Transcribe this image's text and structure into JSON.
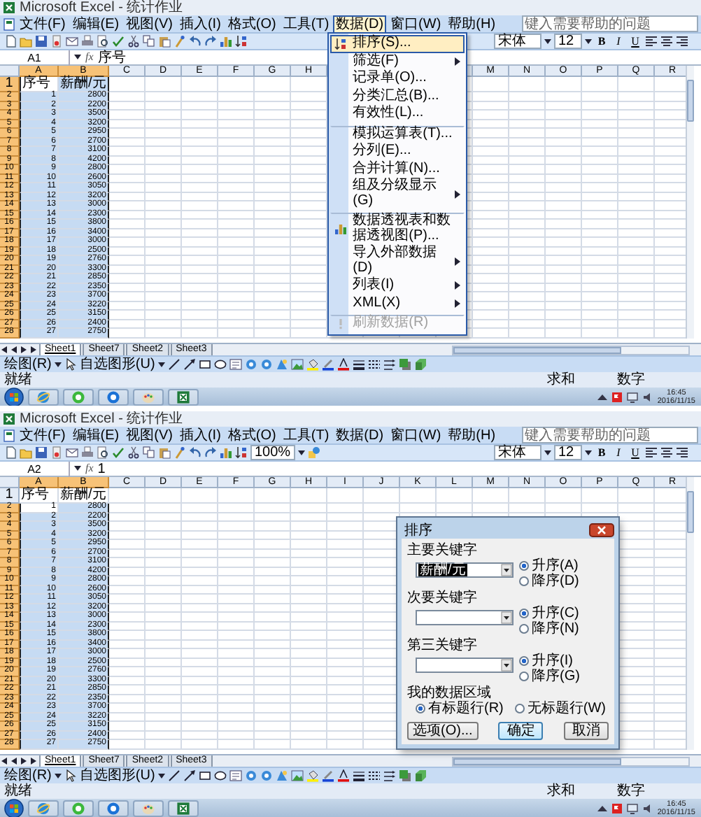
{
  "windows": [
    {
      "title": "Microsoft Excel - 统计作业",
      "menu": [
        {
          "label": "文件(F)",
          "selected": false
        },
        {
          "label": "编辑(E)",
          "selected": false
        },
        {
          "label": "视图(V)",
          "selected": false
        },
        {
          "label": "插入(I)",
          "selected": false
        },
        {
          "label": "格式(O)",
          "selected": false
        },
        {
          "label": "工具(T)",
          "selected": false
        },
        {
          "label": "数据(D)",
          "selected": true
        },
        {
          "label": "窗口(W)",
          "selected": false
        },
        {
          "label": "帮助(H)",
          "selected": false
        }
      ],
      "help_placeholder": "键入需要帮助的问题",
      "dropdown": [
        {
          "label": "排序(S)...",
          "kind": "sort",
          "selected": true,
          "submenu": false,
          "disabled": false,
          "group_start": false
        },
        {
          "label": "筛选(F)",
          "kind": "plain",
          "selected": false,
          "submenu": true,
          "disabled": false,
          "group_start": false
        },
        {
          "label": "记录单(O)...",
          "kind": "plain",
          "selected": false,
          "submenu": false,
          "disabled": false,
          "group_start": false
        },
        {
          "label": "分类汇总(B)...",
          "kind": "plain",
          "selected": false,
          "submenu": false,
          "disabled": false,
          "group_start": false
        },
        {
          "label": "有效性(L)...",
          "kind": "plain",
          "selected": false,
          "submenu": false,
          "disabled": false,
          "group_start": false
        },
        {
          "label": "模拟运算表(T)...",
          "kind": "plain",
          "selected": false,
          "submenu": false,
          "disabled": false,
          "group_start": true
        },
        {
          "label": "分列(E)...",
          "kind": "plain",
          "selected": false,
          "submenu": false,
          "disabled": false,
          "group_start": false
        },
        {
          "label": "合并计算(N)...",
          "kind": "plain",
          "selected": false,
          "submenu": false,
          "disabled": false,
          "group_start": false
        },
        {
          "label": "组及分级显示(G)",
          "kind": "plain",
          "selected": false,
          "submenu": true,
          "disabled": false,
          "group_start": false
        },
        {
          "label": "数据透视表和数据透视图(P)...",
          "kind": "pivot",
          "selected": false,
          "submenu": false,
          "disabled": false,
          "group_start": true
        },
        {
          "label": "导入外部数据(D)",
          "kind": "plain",
          "selected": false,
          "submenu": true,
          "disabled": false,
          "group_start": false
        },
        {
          "label": "列表(I)",
          "kind": "plain",
          "selected": false,
          "submenu": true,
          "disabled": false,
          "group_start": false
        },
        {
          "label": "XML(X)",
          "kind": "plain",
          "selected": false,
          "submenu": true,
          "disabled": false,
          "group_start": false
        },
        {
          "label": "刷新数据(R)",
          "kind": "refresh",
          "selected": false,
          "submenu": false,
          "disabled": true,
          "group_start": true
        }
      ],
      "font_name": "宋体",
      "font_size": "12",
      "format_buttons": [
        "B",
        "I",
        "U"
      ],
      "name_box": "A1",
      "formula_symbol": "fx",
      "formula": "序号",
      "columns": [
        {
          "label": "A",
          "selected": true
        },
        {
          "label": "B",
          "selected": true
        },
        {
          "label": "C",
          "selected": false
        },
        {
          "label": "D",
          "selected": false
        },
        {
          "label": "E",
          "selected": false
        },
        {
          "label": "F",
          "selected": false
        },
        {
          "label": "G",
          "selected": false
        },
        {
          "label": "H",
          "selected": false
        },
        {
          "label": "M",
          "selected": false,
          "after_gap": true
        },
        {
          "label": "N",
          "selected": false
        },
        {
          "label": "O",
          "selected": false
        },
        {
          "label": "P",
          "selected": false
        },
        {
          "label": "Q",
          "selected": false
        },
        {
          "label": "R",
          "selected": false
        }
      ],
      "rows": [
        {
          "n": "1",
          "a": "序号",
          "b": "薪酬/元",
          "kind": "text",
          "selected": true,
          "active": true
        },
        {
          "n": "2",
          "a": "1",
          "b": "2800",
          "kind": "number",
          "selected": true,
          "active": false
        },
        {
          "n": "3",
          "a": "2",
          "b": "2200",
          "kind": "number",
          "selected": true,
          "active": false
        },
        {
          "n": "4",
          "a": "3",
          "b": "3500",
          "kind": "number",
          "selected": true,
          "active": false
        },
        {
          "n": "5",
          "a": "4",
          "b": "3200",
          "kind": "number",
          "selected": true,
          "active": false
        },
        {
          "n": "6",
          "a": "5",
          "b": "2950",
          "kind": "number",
          "selected": true,
          "active": false
        },
        {
          "n": "7",
          "a": "6",
          "b": "2700",
          "kind": "number",
          "selected": true,
          "active": false
        },
        {
          "n": "8",
          "a": "7",
          "b": "3100",
          "kind": "number",
          "selected": true,
          "active": false
        },
        {
          "n": "9",
          "a": "8",
          "b": "4200",
          "kind": "number",
          "selected": true,
          "active": false
        },
        {
          "n": "10",
          "a": "9",
          "b": "2800",
          "kind": "number",
          "selected": true,
          "active": false
        },
        {
          "n": "11",
          "a": "10",
          "b": "2600",
          "kind": "number",
          "selected": true,
          "active": false
        },
        {
          "n": "12",
          "a": "11",
          "b": "3050",
          "kind": "number",
          "selected": true,
          "active": false
        },
        {
          "n": "13",
          "a": "12",
          "b": "3200",
          "kind": "number",
          "selected": true,
          "active": false
        },
        {
          "n": "14",
          "a": "13",
          "b": "3000",
          "kind": "number",
          "selected": true,
          "active": false
        },
        {
          "n": "15",
          "a": "14",
          "b": "2300",
          "kind": "number",
          "selected": true,
          "active": false
        },
        {
          "n": "16",
          "a": "15",
          "b": "3800",
          "kind": "number",
          "selected": true,
          "active": false
        },
        {
          "n": "17",
          "a": "16",
          "b": "3400",
          "kind": "number",
          "selected": true,
          "active": false
        },
        {
          "n": "18",
          "a": "17",
          "b": "3000",
          "kind": "number",
          "selected": true,
          "active": false
        },
        {
          "n": "19",
          "a": "18",
          "b": "2500",
          "kind": "number",
          "selected": true,
          "active": false
        },
        {
          "n": "20",
          "a": "19",
          "b": "2760",
          "kind": "number",
          "selected": true,
          "active": false
        },
        {
          "n": "21",
          "a": "20",
          "b": "3300",
          "kind": "number",
          "selected": true,
          "active": false
        },
        {
          "n": "22",
          "a": "21",
          "b": "2850",
          "kind": "number",
          "selected": true,
          "active": false
        },
        {
          "n": "23",
          "a": "22",
          "b": "2350",
          "kind": "number",
          "selected": true,
          "active": false
        },
        {
          "n": "24",
          "a": "23",
          "b": "3700",
          "kind": "number",
          "selected": true,
          "active": false
        },
        {
          "n": "25",
          "a": "24",
          "b": "3220",
          "kind": "number",
          "selected": true,
          "active": false
        },
        {
          "n": "26",
          "a": "25",
          "b": "3150",
          "kind": "number",
          "selected": true,
          "active": false
        },
        {
          "n": "27",
          "a": "26",
          "b": "2400",
          "kind": "number",
          "selected": true,
          "active": false
        },
        {
          "n": "28",
          "a": "27",
          "b": "2750",
          "kind": "number",
          "selected": true,
          "active": false
        }
      ],
      "sheets": [
        {
          "label": "Sheet1",
          "selected": true
        },
        {
          "label": "Sheet7",
          "selected": false
        },
        {
          "label": "Sheet2",
          "selected": false
        },
        {
          "label": "Sheet3",
          "selected": false
        }
      ],
      "draw_menu": "绘图(R)",
      "autoshapes": "自选图形(U)",
      "status": "就绪",
      "status_right": [
        "求和",
        "数字"
      ],
      "clock_time": "16:45",
      "clock_date": "2016/11/15"
    },
    {
      "title": "Microsoft Excel - 统计作业",
      "menu": [
        {
          "label": "文件(F)",
          "selected": false
        },
        {
          "label": "编辑(E)",
          "selected": false
        },
        {
          "label": "视图(V)",
          "selected": false
        },
        {
          "label": "插入(I)",
          "selected": false
        },
        {
          "label": "格式(O)",
          "selected": false
        },
        {
          "label": "工具(T)",
          "selected": false
        },
        {
          "label": "数据(D)",
          "selected": false
        },
        {
          "label": "窗口(W)",
          "selected": false
        },
        {
          "label": "帮助(H)",
          "selected": false
        }
      ],
      "help_placeholder": "键入需要帮助的问题",
      "zoom": "100%",
      "font_name": "宋体",
      "font_size": "12",
      "format_buttons": [
        "B",
        "I",
        "U"
      ],
      "name_box": "A2",
      "formula_symbol": "fx",
      "formula": "1",
      "columns": [
        {
          "label": "A",
          "selected": true
        },
        {
          "label": "B",
          "selected": true
        },
        {
          "label": "C",
          "selected": false
        },
        {
          "label": "D",
          "selected": false
        },
        {
          "label": "E",
          "selected": false
        },
        {
          "label": "F",
          "selected": false
        },
        {
          "label": "G",
          "selected": false
        },
        {
          "label": "H",
          "selected": false
        },
        {
          "label": "I",
          "selected": false
        },
        {
          "label": "J",
          "selected": false
        },
        {
          "label": "K",
          "selected": false
        },
        {
          "label": "L",
          "selected": false
        },
        {
          "label": "M",
          "selected": false
        },
        {
          "label": "N",
          "selected": false
        },
        {
          "label": "O",
          "selected": false
        },
        {
          "label": "P",
          "selected": false
        },
        {
          "label": "Q",
          "selected": false
        },
        {
          "label": "R",
          "selected": false
        }
      ],
      "rows": [
        {
          "n": "1",
          "a": "序号",
          "b": "薪酬/元",
          "kind": "text",
          "selected": false,
          "active": false
        },
        {
          "n": "2",
          "a": "1",
          "b": "2800",
          "kind": "number",
          "selected": true,
          "active": true
        },
        {
          "n": "3",
          "a": "2",
          "b": "2200",
          "kind": "number",
          "selected": true,
          "active": false
        },
        {
          "n": "4",
          "a": "3",
          "b": "3500",
          "kind": "number",
          "selected": true,
          "active": false
        },
        {
          "n": "5",
          "a": "4",
          "b": "3200",
          "kind": "number",
          "selected": true,
          "active": false
        },
        {
          "n": "6",
          "a": "5",
          "b": "2950",
          "kind": "number",
          "selected": true,
          "active": false
        },
        {
          "n": "7",
          "a": "6",
          "b": "2700",
          "kind": "number",
          "selected": true,
          "active": false
        },
        {
          "n": "8",
          "a": "7",
          "b": "3100",
          "kind": "number",
          "selected": true,
          "active": false
        },
        {
          "n": "9",
          "a": "8",
          "b": "4200",
          "kind": "number",
          "selected": true,
          "active": false
        },
        {
          "n": "10",
          "a": "9",
          "b": "2800",
          "kind": "number",
          "selected": true,
          "active": false
        },
        {
          "n": "11",
          "a": "10",
          "b": "2600",
          "kind": "number",
          "selected": true,
          "active": false
        },
        {
          "n": "12",
          "a": "11",
          "b": "3050",
          "kind": "number",
          "selected": true,
          "active": false
        },
        {
          "n": "13",
          "a": "12",
          "b": "3200",
          "kind": "number",
          "selected": true,
          "active": false
        },
        {
          "n": "14",
          "a": "13",
          "b": "3000",
          "kind": "number",
          "selected": true,
          "active": false
        },
        {
          "n": "15",
          "a": "14",
          "b": "2300",
          "kind": "number",
          "selected": true,
          "active": false
        },
        {
          "n": "16",
          "a": "15",
          "b": "3800",
          "kind": "number",
          "selected": true,
          "active": false
        },
        {
          "n": "17",
          "a": "16",
          "b": "3400",
          "kind": "number",
          "selected": true,
          "active": false
        },
        {
          "n": "18",
          "a": "17",
          "b": "3000",
          "kind": "number",
          "selected": true,
          "active": false
        },
        {
          "n": "19",
          "a": "18",
          "b": "2500",
          "kind": "number",
          "selected": true,
          "active": false
        },
        {
          "n": "20",
          "a": "19",
          "b": "2760",
          "kind": "number",
          "selected": true,
          "active": false
        },
        {
          "n": "21",
          "a": "20",
          "b": "3300",
          "kind": "number",
          "selected": true,
          "active": false
        },
        {
          "n": "22",
          "a": "21",
          "b": "2850",
          "kind": "number",
          "selected": true,
          "active": false
        },
        {
          "n": "23",
          "a": "22",
          "b": "2350",
          "kind": "number",
          "selected": true,
          "active": false
        },
        {
          "n": "24",
          "a": "23",
          "b": "3700",
          "kind": "number",
          "selected": true,
          "active": false
        },
        {
          "n": "25",
          "a": "24",
          "b": "3220",
          "kind": "number",
          "selected": true,
          "active": false
        },
        {
          "n": "26",
          "a": "25",
          "b": "3150",
          "kind": "number",
          "selected": true,
          "active": false
        },
        {
          "n": "27",
          "a": "26",
          "b": "2400",
          "kind": "number",
          "selected": true,
          "active": false
        },
        {
          "n": "28",
          "a": "27",
          "b": "2750",
          "kind": "number",
          "selected": true,
          "active": false
        }
      ],
      "sheets": [
        {
          "label": "Sheet1",
          "selected": true
        },
        {
          "label": "Sheet7",
          "selected": false
        },
        {
          "label": "Sheet2",
          "selected": false
        },
        {
          "label": "Sheet3",
          "selected": false
        }
      ],
      "draw_menu": "绘图(R)",
      "autoshapes": "自选图形(U)",
      "status": "就绪",
      "status_right": [
        "求和",
        "数字"
      ],
      "clock_time": "16:45",
      "clock_date": "2016/11/15",
      "dialog": {
        "title": "排序",
        "keys": [
          {
            "label": "主要关键字",
            "value": "薪酬/元",
            "value_selected": true,
            "options": [
              {
                "label": "升序(A)",
                "selected": true
              },
              {
                "label": "降序(D)",
                "selected": false
              }
            ]
          },
          {
            "label": "次要关键字",
            "options": [
              {
                "label": "升序(C)",
                "selected": true
              },
              {
                "label": "降序(N)",
                "selected": false
              }
            ]
          },
          {
            "label": "第三关键字",
            "options": [
              {
                "label": "升序(I)",
                "selected": true
              },
              {
                "label": "降序(G)",
                "selected": false
              }
            ]
          }
        ],
        "range_label": "我的数据区域",
        "range_options": [
          {
            "label": "有标题行(R)",
            "selected": true
          },
          {
            "label": "无标题行(W)",
            "selected": false
          }
        ],
        "buttons": [
          {
            "label": "选项(O)...",
            "default": false
          },
          {
            "label": "确定",
            "default": true
          },
          {
            "label": "取消",
            "default": false
          }
        ]
      }
    }
  ]
}
